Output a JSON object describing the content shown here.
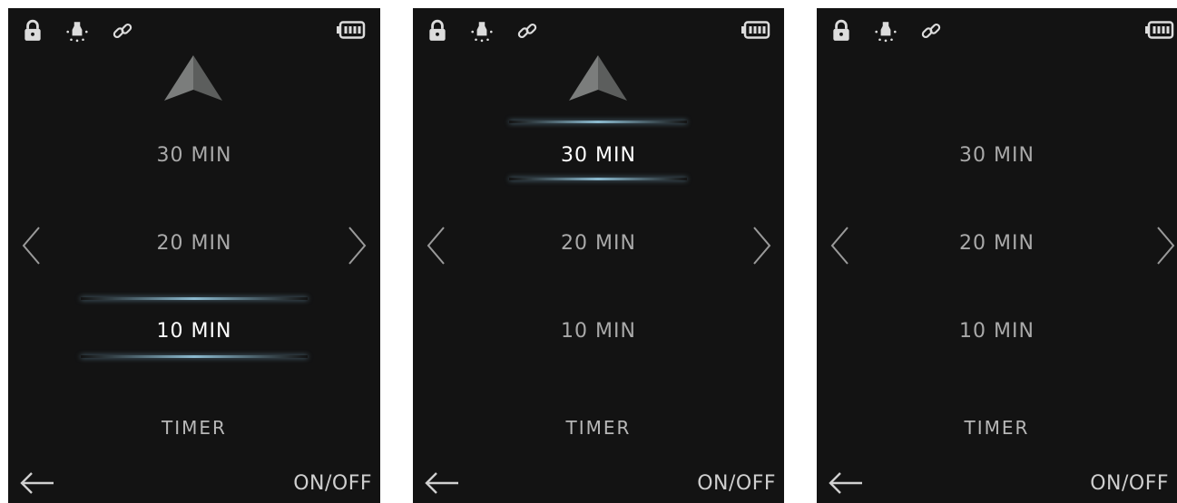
{
  "panels": [
    {
      "options": [
        "30 MIN",
        "20 MIN",
        "10 MIN"
      ],
      "selected": "10 MIN",
      "show_up_arrow": true,
      "mode_label": "TIMER",
      "onoff_label": "ON/OFF"
    },
    {
      "options": [
        "30 MIN",
        "20 MIN",
        "10 MIN"
      ],
      "selected": "30 MIN",
      "show_up_arrow": true,
      "mode_label": "TIMER",
      "onoff_label": "ON/OFF"
    },
    {
      "options": [
        "30 MIN",
        "20 MIN",
        "10 MIN"
      ],
      "selected": null,
      "show_up_arrow": false,
      "mode_label": "TIMER",
      "onoff_label": "ON/OFF"
    }
  ],
  "status_icons": [
    "lock-icon",
    "light-icon",
    "link-icon",
    "battery-icon"
  ],
  "colors": {
    "background": "#131313",
    "text_dim": "#a9a9a9",
    "text_selected": "#ffffff",
    "highlight_glow": "#a0d7f0",
    "arrow": "#6e706f"
  }
}
